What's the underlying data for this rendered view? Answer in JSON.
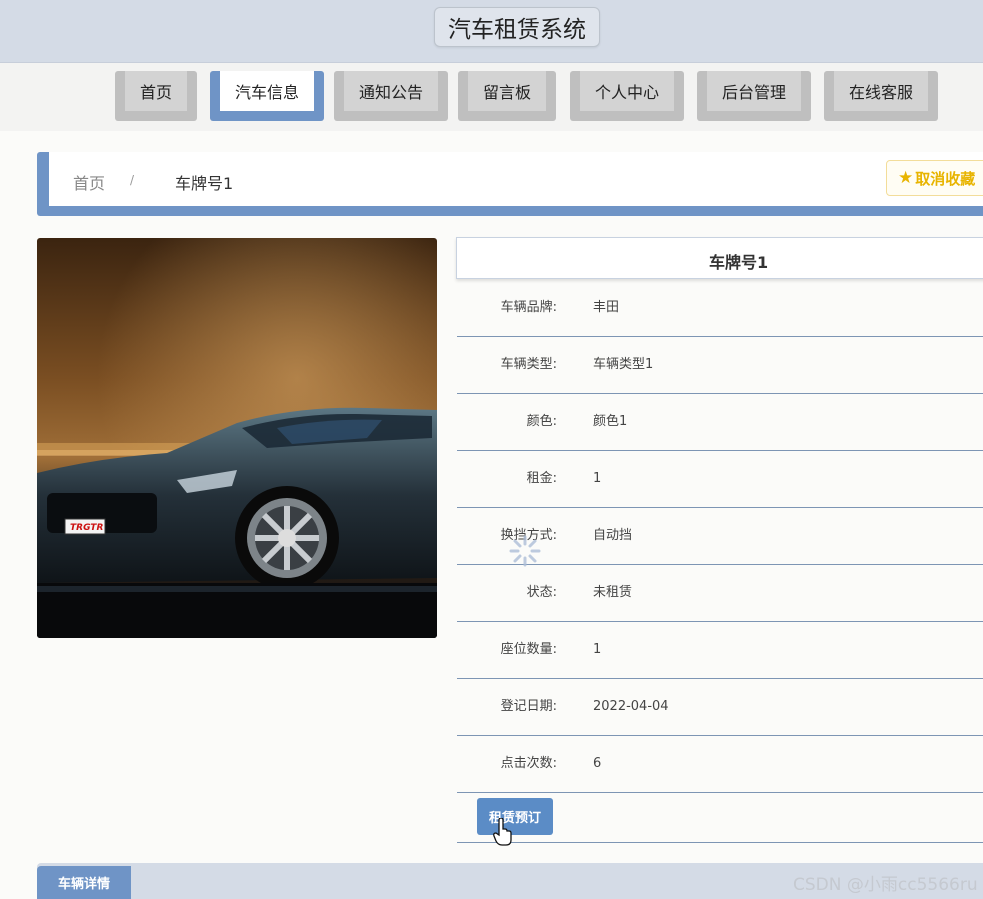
{
  "header": {
    "title": "汽车租赁系统"
  },
  "nav": {
    "items": [
      {
        "label": "首页"
      },
      {
        "label": "汽车信息"
      },
      {
        "label": "通知公告"
      },
      {
        "label": "留言板"
      },
      {
        "label": "个人中心"
      },
      {
        "label": "后台管理"
      },
      {
        "label": "在线客服"
      }
    ],
    "active": "汽车信息"
  },
  "breadcrumb": {
    "home": "首页",
    "separator": "/",
    "current": "车牌号1"
  },
  "favorite": {
    "label": "取消收藏",
    "icon": "star-icon",
    "color": "#e8b400"
  },
  "detail": {
    "title": "车牌号1",
    "rows": [
      {
        "label": "车辆品牌:",
        "value": "丰田"
      },
      {
        "label": "车辆类型:",
        "value": "车辆类型1"
      },
      {
        "label": "颜色:",
        "value": "颜色1"
      },
      {
        "label": "租金:",
        "value": "1"
      },
      {
        "label": "换挡方式:",
        "value": "自动挡"
      },
      {
        "label": "状态:",
        "value": "未租赁"
      },
      {
        "label": "座位数量:",
        "value": "1"
      },
      {
        "label": "登记日期:",
        "value": "2022-04-04"
      },
      {
        "label": "点击次数:",
        "value": "6"
      }
    ],
    "rent_button": "租赁预订"
  },
  "photo": {
    "plate": "TRGTR"
  },
  "tabs": {
    "active": "车辆详情"
  },
  "watermark": "CSDN @小雨cc5566ru",
  "colors": {
    "accent": "#6f94c6",
    "button": "#5b8cc6",
    "header_bg": "#d4dbe6"
  }
}
